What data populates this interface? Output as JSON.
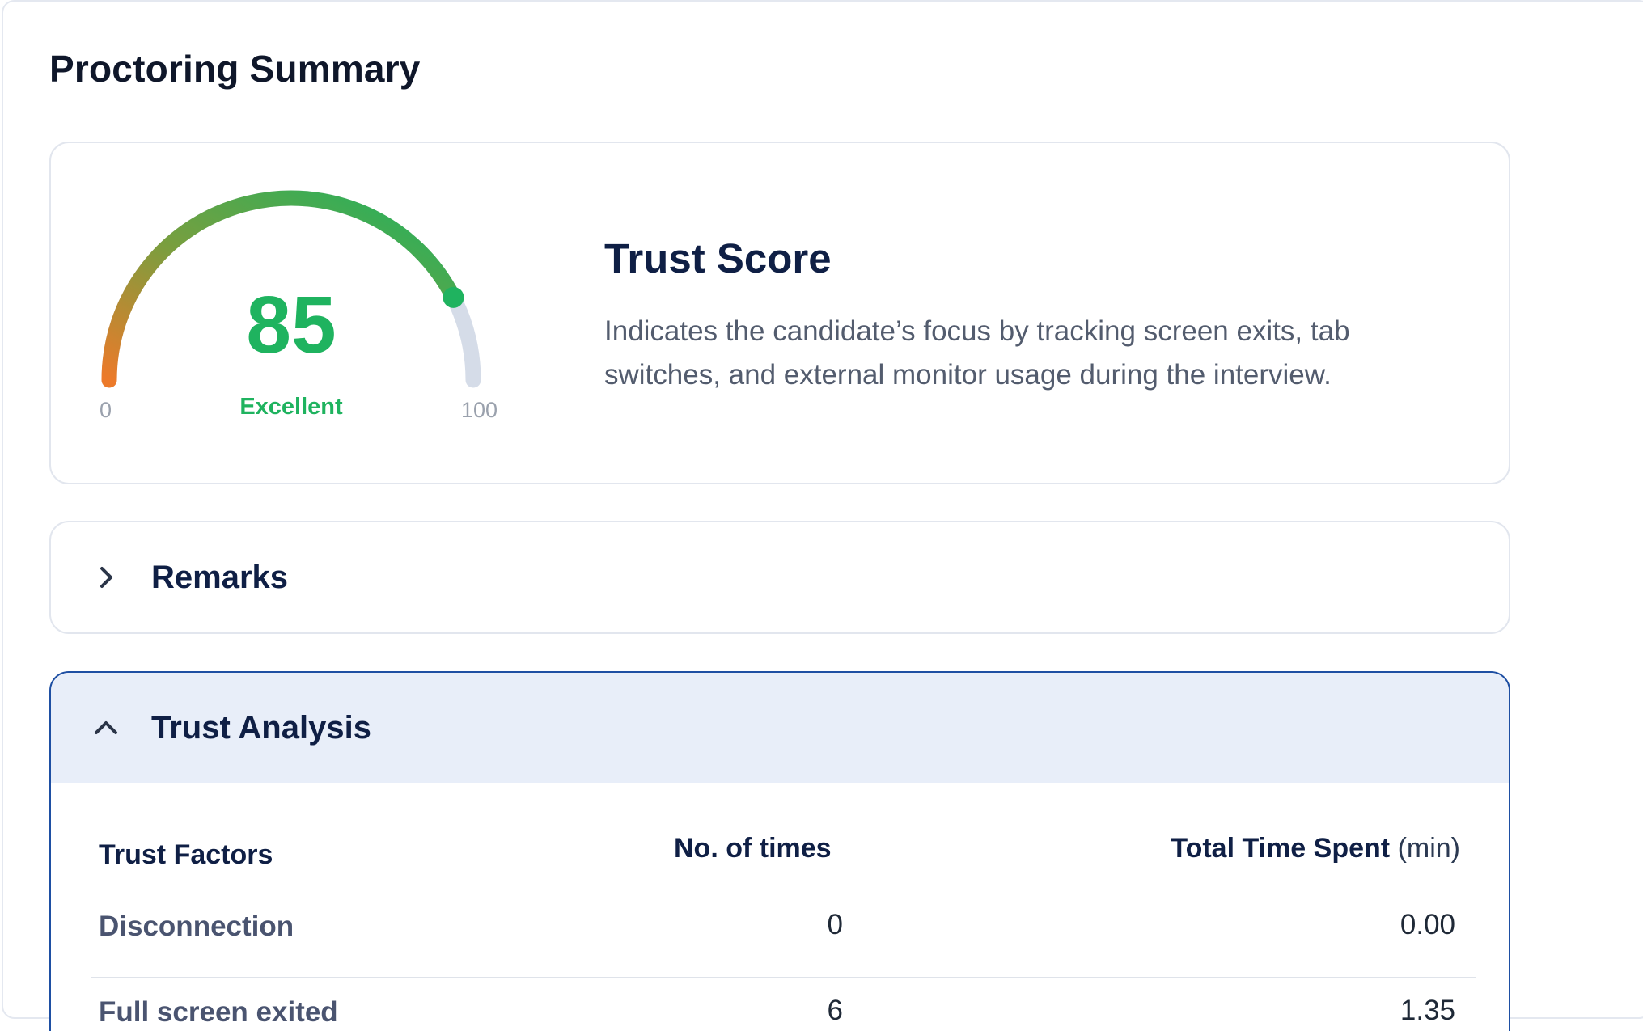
{
  "page": {
    "title": "Proctoring Summary"
  },
  "trust_score": {
    "value": "85",
    "score_fraction": 0.85,
    "status": "Excellent",
    "min_label": "0",
    "max_label": "100",
    "title": "Trust Score",
    "description": "Indicates the candidate’s focus by tracking screen exits, tab switches, and external monitor usage during the interview.",
    "colors": {
      "start": "#ec7a2a",
      "mid": "#7a9e3e",
      "end": "#1fb35f",
      "track": "#d5dce8",
      "text": "#1fb35f"
    }
  },
  "remarks": {
    "title": "Remarks",
    "expanded": false,
    "icon": "chevron-right-icon"
  },
  "trust_analysis": {
    "title": "Trust Analysis",
    "expanded": true,
    "icon": "chevron-up-icon",
    "columns": {
      "factor": "Trust Factors",
      "count": "No. of times",
      "time": "Total Time Spent",
      "time_unit": "(min)"
    },
    "rows": [
      {
        "factor": "Disconnection",
        "count": "0",
        "time": "0.00"
      },
      {
        "factor": "Full screen exited",
        "count": "6",
        "time": "1.35"
      }
    ]
  }
}
